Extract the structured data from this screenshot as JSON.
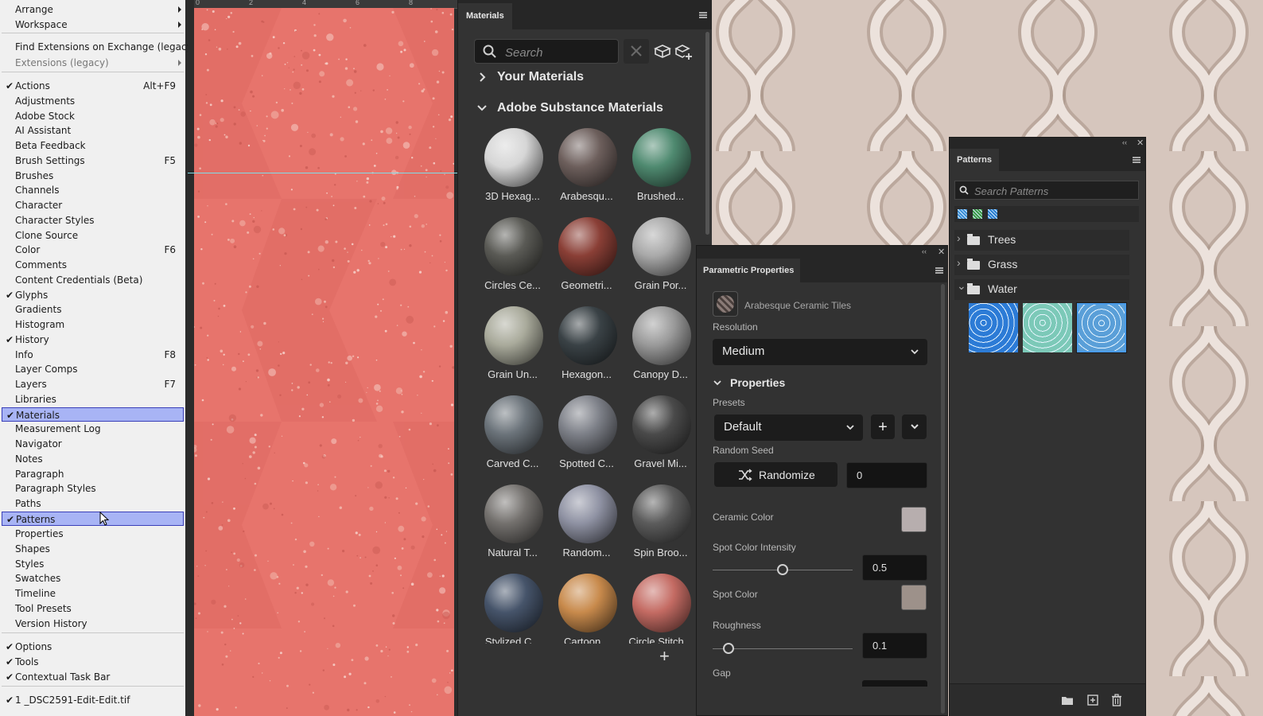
{
  "menu": {
    "items": [
      {
        "label": "Arrange",
        "submenu": true
      },
      {
        "label": "Workspace",
        "submenu": true
      },
      {
        "label": "Find Extensions on Exchange (legacy)..."
      },
      {
        "label": "Extensions (legacy)",
        "submenu": true,
        "disabled": true
      },
      {
        "label": "Actions",
        "checked": true,
        "shortcut": "Alt+F9"
      },
      {
        "label": "Adjustments"
      },
      {
        "label": "Adobe Stock"
      },
      {
        "label": "AI Assistant"
      },
      {
        "label": "Beta Feedback"
      },
      {
        "label": "Brush Settings",
        "shortcut": "F5"
      },
      {
        "label": "Brushes"
      },
      {
        "label": "Channels"
      },
      {
        "label": "Character"
      },
      {
        "label": "Character Styles"
      },
      {
        "label": "Clone Source"
      },
      {
        "label": "Color",
        "shortcut": "F6"
      },
      {
        "label": "Comments"
      },
      {
        "label": "Content Credentials (Beta)"
      },
      {
        "label": "Glyphs",
        "checked": true
      },
      {
        "label": "Gradients"
      },
      {
        "label": "Histogram"
      },
      {
        "label": "History",
        "checked": true
      },
      {
        "label": "Info",
        "shortcut": "F8"
      },
      {
        "label": "Layer Comps"
      },
      {
        "label": "Layers",
        "shortcut": "F7"
      },
      {
        "label": "Libraries"
      },
      {
        "label": "Materials",
        "checked": true,
        "highlighted": true
      },
      {
        "label": "Measurement Log"
      },
      {
        "label": "Navigator"
      },
      {
        "label": "Notes"
      },
      {
        "label": "Paragraph"
      },
      {
        "label": "Paragraph Styles"
      },
      {
        "label": "Paths"
      },
      {
        "label": "Patterns",
        "checked": true,
        "highlighted": true
      },
      {
        "label": "Properties"
      },
      {
        "label": "Shapes"
      },
      {
        "label": "Styles"
      },
      {
        "label": "Swatches"
      },
      {
        "label": "Timeline"
      },
      {
        "label": "Tool Presets"
      },
      {
        "label": "Version History"
      },
      {
        "label": "Options",
        "checked": true
      },
      {
        "label": "Tools",
        "checked": true
      },
      {
        "label": "Contextual Task Bar",
        "checked": true
      },
      {
        "label": "1 _DSC2591-Edit-Edit.tif",
        "checked": true
      }
    ]
  },
  "ruler": {
    "ticks": [
      "0",
      "2",
      "4",
      "6",
      "8"
    ]
  },
  "materials": {
    "tab_label": "Materials",
    "search_placeholder": "Search",
    "section_yours": "Your Materials",
    "section_adobe": "Adobe Substance Materials",
    "tiles": [
      {
        "label": "3D Hexag...",
        "color": "#d6d6d6"
      },
      {
        "label": "Arabesqu...",
        "color": "#6d5f5c"
      },
      {
        "label": "Brushed...",
        "color": "#4f8a70"
      },
      {
        "label": "Circles Ce...",
        "color": "#5a5a55"
      },
      {
        "label": "Geometri...",
        "color": "#8a3f36"
      },
      {
        "label": "Grain Por...",
        "color": "#a9a9a9"
      },
      {
        "label": "Grain Un...",
        "color": "#a9aa9b"
      },
      {
        "label": "Hexagon...",
        "color": "#3a4246"
      },
      {
        "label": "Canopy D...",
        "color": "#9a9a9a"
      },
      {
        "label": "Carved C...",
        "color": "#6b737a"
      },
      {
        "label": "Spotted C...",
        "color": "#7d8088"
      },
      {
        "label": "Gravel Mi...",
        "color": "#4a4a4a"
      },
      {
        "label": "Natural T...",
        "color": "#74716e"
      },
      {
        "label": "Random...",
        "color": "#8f92a3"
      },
      {
        "label": "Spin Broo...",
        "color": "#5c5c5c"
      },
      {
        "label": "Stylized C...",
        "color": "#46546a"
      },
      {
        "label": "Cartoon...",
        "color": "#c88a4c"
      },
      {
        "label": "Circle Stitch...",
        "color": "#c46b63"
      }
    ]
  },
  "param": {
    "tab_label": "Parametric Properties",
    "material_name": "Arabesque Ceramic Tiles",
    "resolution_label": "Resolution",
    "resolution_value": "Medium",
    "properties_label": "Properties",
    "presets_label": "Presets",
    "presets_value": "Default",
    "seed_label": "Random Seed",
    "randomize_label": "Randomize",
    "seed_value": "0",
    "ceramic_color_label": "Ceramic Color",
    "ceramic_color": "#b7aeae",
    "spot_intensity_label": "Spot Color Intensity",
    "spot_intensity_value": "0.5",
    "spot_intensity_fraction": 0.5,
    "spot_color_label": "Spot Color",
    "spot_color": "#9d918a",
    "roughness_label": "Roughness",
    "roughness_value": "0.1",
    "roughness_fraction": 0.1,
    "gap_label": "Gap"
  },
  "patterns": {
    "tab_label": "Patterns",
    "search_placeholder": "Search Patterns",
    "folders": [
      {
        "label": "Trees",
        "expanded": false
      },
      {
        "label": "Grass",
        "expanded": false
      },
      {
        "label": "Water",
        "expanded": true
      }
    ],
    "recent_colors": [
      "#3b8fd6",
      "#3a9a45",
      "#2a7fd0"
    ],
    "water_thumbs": [
      "#2c7bd6",
      "#7cc9b8",
      "#5a9fd8"
    ]
  },
  "colors": {
    "menu_highlight": "#a8b4f5",
    "canvas_coral": "#e7746c",
    "panel_bg": "#323232"
  }
}
